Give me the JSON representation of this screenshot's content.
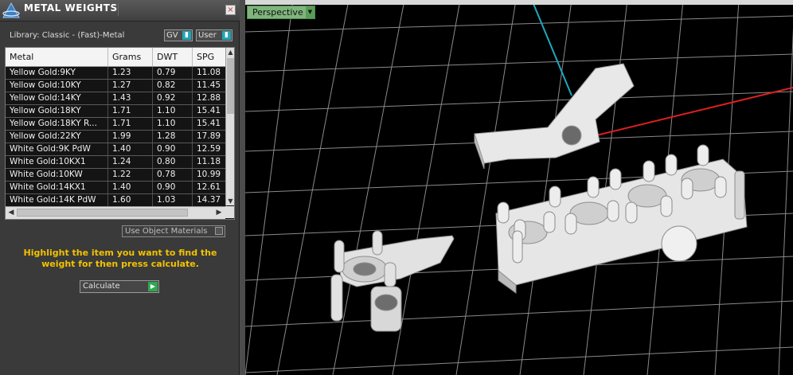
{
  "panel": {
    "title": "METAL WEIGHTS",
    "close_label": "×",
    "library": "Library: Classic - (Fast)-Metal",
    "toggle_gv": "GV",
    "toggle_user": "User",
    "use_object_materials": "Use Object Materials",
    "hint": "Highlight the item you want to find the weight for then press calculate.",
    "calculate_label": "Calculate"
  },
  "table": {
    "columns": [
      "Metal",
      "Grams",
      "DWT",
      "SPG"
    ],
    "rows": [
      [
        "Yellow Gold:9KY",
        "1.23",
        "0.79",
        "11.08"
      ],
      [
        "Yellow Gold:10KY",
        "1.27",
        "0.82",
        "11.45"
      ],
      [
        "Yellow Gold:14KY",
        "1.43",
        "0.92",
        "12.88"
      ],
      [
        "Yellow Gold:18KY",
        "1.71",
        "1.10",
        "15.41"
      ],
      [
        "Yellow Gold:18KY R...",
        "1.71",
        "1.10",
        "15.41"
      ],
      [
        "Yellow Gold:22KY",
        "1.99",
        "1.28",
        "17.89"
      ],
      [
        "White Gold:9K PdW",
        "1.40",
        "0.90",
        "12.59"
      ],
      [
        "White Gold:10KX1",
        "1.24",
        "0.80",
        "11.18"
      ],
      [
        "White Gold:10KW",
        "1.22",
        "0.78",
        "10.99"
      ],
      [
        "White Gold:14KX1",
        "1.40",
        "0.90",
        "12.61"
      ],
      [
        "White Gold:14K PdW",
        "1.60",
        "1.03",
        "14.37"
      ]
    ]
  },
  "viewport": {
    "view_mode": "Perspective"
  },
  "colors": {
    "accent_toggle": "#23a4b8",
    "hint_text": "#f2c200",
    "perspective_button": "#7fb57c",
    "calculate_go": "#2fa84f"
  }
}
